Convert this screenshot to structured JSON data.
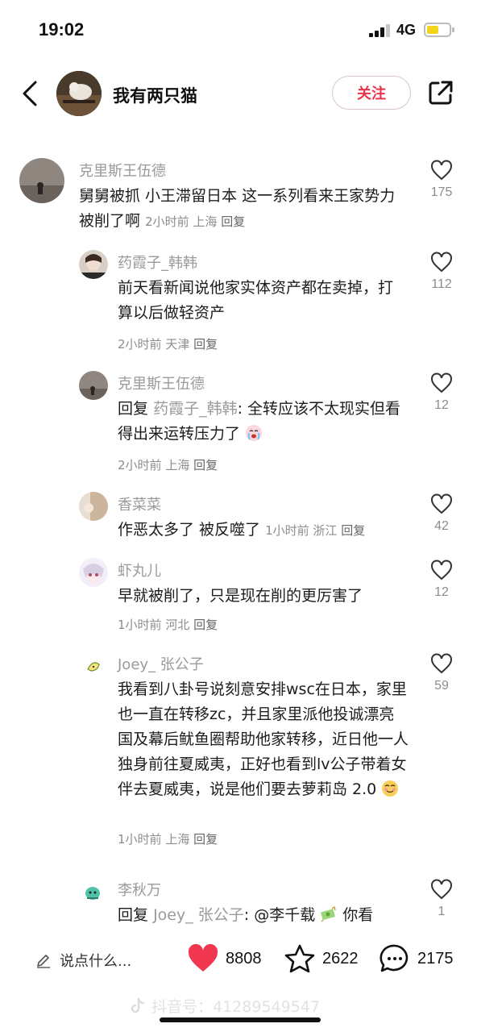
{
  "status": {
    "time": "19:02",
    "network": "4G"
  },
  "header": {
    "title": "我有两只猫",
    "follow_label": "关注"
  },
  "comments": [
    {
      "user": "克里斯王伍德",
      "text": "舅舅被抓 小王滞留日本 这一系列看来王家势力被削了啊",
      "time": "2小时前",
      "location": "上海",
      "reply": "回复",
      "likes": "175"
    },
    {
      "user": "药霞子_韩韩",
      "text": "前天看新闻说他家实体资产都在卖掉，打算以后做轻资产",
      "time": "2小时前",
      "location": "天津",
      "reply": "回复",
      "likes": "112"
    },
    {
      "user": "克里斯王伍德",
      "reply_prefix": "回复",
      "reply_target": "药霞子_韩韩",
      "text": ": 全转应该不太现实但看得出来运转压力了",
      "time": "2小时前",
      "location": "上海",
      "reply": "回复",
      "likes": "12"
    },
    {
      "user": "香菜菜",
      "text": "作恶太多了 被反噬了",
      "time": "1小时前",
      "location": "浙江",
      "reply": "回复",
      "likes": "42"
    },
    {
      "user": "虾丸儿",
      "text": "早就被削了，只是现在削的更厉害了",
      "time": "1小时前",
      "location": "河北",
      "reply": "回复",
      "likes": "12"
    },
    {
      "user": "Joey_ 张公子",
      "text": "我看到八卦号说刻意安排wsc在日本，家里也一直在转移zc，并且家里派他投诚漂亮国及幕后鱿鱼圈帮助他家转移，近日他一人独身前往夏威夷，正好也看到lv公子带着女伴去夏威夷，说是他们要去萝莉岛 2.0",
      "time": "1小时前",
      "location": "上海",
      "reply": "回复",
      "likes": "59"
    },
    {
      "user": "李秋万",
      "reply_prefix": "回复",
      "reply_target": "Joey_ 张公子",
      "text": ": @李千载",
      "text_tail": " 你看",
      "likes": "1"
    }
  ],
  "bottom": {
    "input_placeholder": "说点什么...",
    "likes": "8808",
    "favorites": "2622",
    "comments": "2175"
  },
  "watermark": "抖音号：41289549547",
  "colors": {
    "accent_red": "#e8344b",
    "heart_red": "#f0374f"
  }
}
